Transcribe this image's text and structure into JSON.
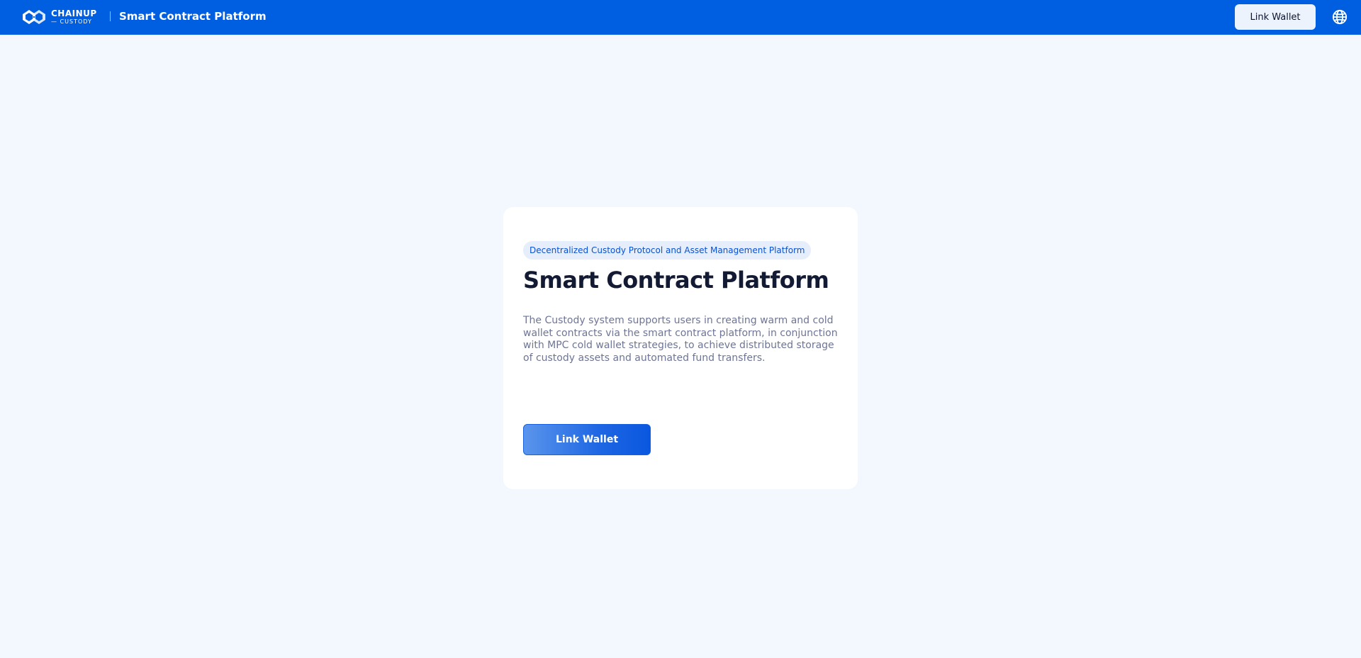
{
  "header": {
    "logo": {
      "brand": "CHAINUP",
      "sub": "— CUSTODY",
      "icon": "chainup-logo-icon"
    },
    "title": "Smart Contract Platform",
    "link_wallet_label": "Link Wallet",
    "language_icon": "globe-icon",
    "background_color": "#005ee0"
  },
  "card": {
    "tag": "Decentralized Custody Protocol and Asset Management Platform",
    "title": "Smart Contract Platform",
    "description": "The Custody system supports users in creating warm and cold wallet contracts via the smart contract platform, in conjunction with MPC cold wallet strategies, to achieve distributed storage of custody assets and automated fund transfers.",
    "button_label": "Link Wallet"
  },
  "colors": {
    "accent": "#005ee0",
    "page_background": "#f3f7fe",
    "title_text": "#131a33",
    "body_text": "#6e7595"
  }
}
